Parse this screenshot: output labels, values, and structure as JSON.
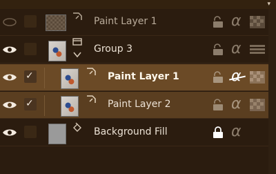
{
  "toolbar": {
    "menu_arrow": "▾"
  },
  "layers": [
    {
      "name": "Paint Layer 1",
      "visible": false,
      "checked": false,
      "type_icon": "paint-layer-icon",
      "thumb": "checker",
      "locked": false,
      "alpha_disabled": false,
      "selected": false
    },
    {
      "name": "Group 3",
      "visible": true,
      "checked": false,
      "type_icon": "group-layer-icon",
      "thumb": "art",
      "locked": false,
      "alpha_disabled": false,
      "selected": false,
      "expanded": true
    },
    {
      "name": "Paint Layer 1",
      "visible": true,
      "checked": true,
      "type_icon": "paint-layer-icon",
      "thumb": "art",
      "locked": false,
      "alpha_disabled": true,
      "selected": true,
      "child": true
    },
    {
      "name": "Paint Layer 2",
      "visible": true,
      "checked": true,
      "type_icon": "paint-layer-icon",
      "thumb": "art",
      "locked": false,
      "alpha_disabled": false,
      "selected": true,
      "child": true
    },
    {
      "name": "Background Fill",
      "visible": true,
      "checked": false,
      "type_icon": "fill-layer-icon",
      "thumb": "gray",
      "locked": true,
      "alpha_disabled": false,
      "selected": false
    }
  ],
  "symbols": {
    "check": "✓",
    "alpha": "α"
  }
}
